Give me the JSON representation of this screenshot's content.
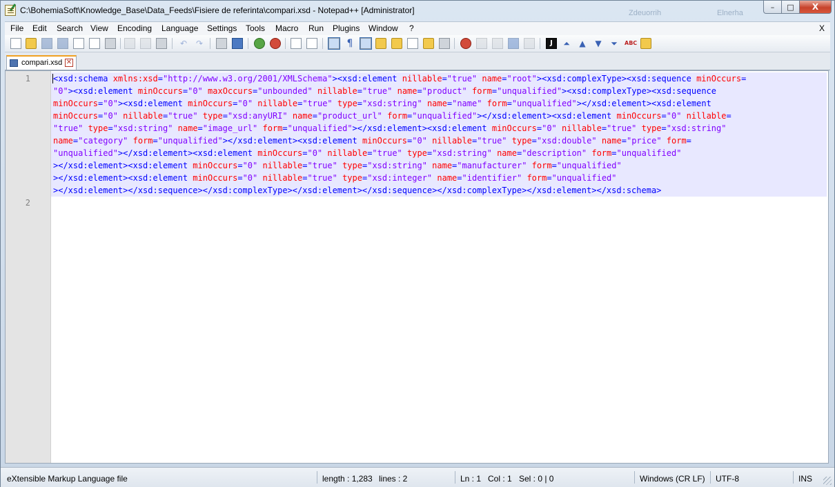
{
  "window": {
    "title": "C:\\BohemiaSoft\\Knowledge_Base\\Data_Feeds\\Fisiere de referinta\\compari.xsd - Notepad++ [Administrator]",
    "min_glyph": "–",
    "max_glyph": "□",
    "close_glyph": "X"
  },
  "background_text": {
    "left": "Zdeuorrih",
    "right": "Elnerha"
  },
  "menu": {
    "items": [
      "File",
      "Edit",
      "Search",
      "View",
      "Encoding",
      "Language",
      "Settings",
      "Tools",
      "Macro",
      "Run",
      "Plugins",
      "Window",
      "?"
    ],
    "close_glyph": "X"
  },
  "toolbar": {
    "icons": [
      "new-file-icon",
      "open-file-icon",
      "save-icon",
      "save-all-icon",
      "close-icon",
      "close-all-icon",
      "print-icon",
      "cut-icon",
      "copy-icon",
      "paste-icon",
      "undo-icon",
      "redo-icon",
      "find-icon",
      "replace-icon",
      "zoom-in-icon",
      "zoom-out-icon",
      "sync-vertical-icon",
      "sync-horizontal-icon",
      "word-wrap-icon",
      "show-all-chars-icon",
      "indent-guide-icon",
      "user-language-icon",
      "doc-map-icon",
      "function-list-icon",
      "folder-workspace-icon",
      "monitoring-icon",
      "record-macro-icon",
      "stop-macro-icon",
      "play-macro-icon",
      "run-macro-multiple-icon",
      "save-macro-icon",
      "jslint-icon",
      "collapse-icon",
      "up-arrow-icon",
      "down-arrow-icon",
      "expand-icon",
      "spell-check-icon",
      "compare-icon"
    ],
    "black_box_glyph": "J",
    "pilcrow_glyph": "¶",
    "abc_glyph": "ABC"
  },
  "tabs": [
    {
      "label": "compari.xsd",
      "close_glyph": "✕"
    }
  ],
  "editor": {
    "line_numbers": [
      "1",
      "2"
    ],
    "lines": [
      [
        [
          "t",
          "<xsd:schema "
        ],
        [
          "a",
          "xmlns:xsd"
        ],
        [
          "t",
          "="
        ],
        [
          "v",
          "\"http://www.w3.org/2001/XMLSchema\""
        ],
        [
          "t",
          "><xsd:element "
        ],
        [
          "a",
          "nillable"
        ],
        [
          "t",
          "="
        ],
        [
          "v",
          "\"true\" "
        ],
        [
          "a",
          "name"
        ],
        [
          "t",
          "="
        ],
        [
          "v",
          "\"root\""
        ],
        [
          "t",
          "><xsd:complexType><xsd:sequence "
        ],
        [
          "a",
          "minOccurs"
        ],
        [
          "t",
          "="
        ]
      ],
      [
        [
          "v",
          "\"0\""
        ],
        [
          "t",
          "><xsd:element "
        ],
        [
          "a",
          "minOccurs"
        ],
        [
          "t",
          "="
        ],
        [
          "v",
          "\"0\" "
        ],
        [
          "a",
          "maxOccurs"
        ],
        [
          "t",
          "="
        ],
        [
          "v",
          "\"unbounded\" "
        ],
        [
          "a",
          "nillable"
        ],
        [
          "t",
          "="
        ],
        [
          "v",
          "\"true\" "
        ],
        [
          "a",
          "name"
        ],
        [
          "t",
          "="
        ],
        [
          "v",
          "\"product\" "
        ],
        [
          "a",
          "form"
        ],
        [
          "t",
          "="
        ],
        [
          "v",
          "\"unqualified\""
        ],
        [
          "t",
          "><xsd:complexType><xsd:sequence"
        ]
      ],
      [
        [
          "a",
          "minOccurs"
        ],
        [
          "t",
          "="
        ],
        [
          "v",
          "\"0\""
        ],
        [
          "t",
          "><xsd:element "
        ],
        [
          "a",
          "minOccurs"
        ],
        [
          "t",
          "="
        ],
        [
          "v",
          "\"0\" "
        ],
        [
          "a",
          "nillable"
        ],
        [
          "t",
          "="
        ],
        [
          "v",
          "\"true\" "
        ],
        [
          "a",
          "type"
        ],
        [
          "t",
          "="
        ],
        [
          "v",
          "\"xsd:string\" "
        ],
        [
          "a",
          "name"
        ],
        [
          "t",
          "="
        ],
        [
          "v",
          "\"name\" "
        ],
        [
          "a",
          "form"
        ],
        [
          "t",
          "="
        ],
        [
          "v",
          "\"unqualified\""
        ],
        [
          "t",
          "></xsd:element><xsd:element"
        ]
      ],
      [
        [
          "a",
          "minOccurs"
        ],
        [
          "t",
          "="
        ],
        [
          "v",
          "\"0\" "
        ],
        [
          "a",
          "nillable"
        ],
        [
          "t",
          "="
        ],
        [
          "v",
          "\"true\" "
        ],
        [
          "a",
          "type"
        ],
        [
          "t",
          "="
        ],
        [
          "v",
          "\"xsd:anyURI\" "
        ],
        [
          "a",
          "name"
        ],
        [
          "t",
          "="
        ],
        [
          "v",
          "\"product_url\" "
        ],
        [
          "a",
          "form"
        ],
        [
          "t",
          "="
        ],
        [
          "v",
          "\"unqualified\""
        ],
        [
          "t",
          "></xsd:element><xsd:element "
        ],
        [
          "a",
          "minOccurs"
        ],
        [
          "t",
          "="
        ],
        [
          "v",
          "\"0\" "
        ],
        [
          "a",
          "nillable"
        ],
        [
          "t",
          "="
        ]
      ],
      [
        [
          "v",
          "\"true\" "
        ],
        [
          "a",
          "type"
        ],
        [
          "t",
          "="
        ],
        [
          "v",
          "\"xsd:string\" "
        ],
        [
          "a",
          "name"
        ],
        [
          "t",
          "="
        ],
        [
          "v",
          "\"image_url\" "
        ],
        [
          "a",
          "form"
        ],
        [
          "t",
          "="
        ],
        [
          "v",
          "\"unqualified\""
        ],
        [
          "t",
          "></xsd:element><xsd:element "
        ],
        [
          "a",
          "minOccurs"
        ],
        [
          "t",
          "="
        ],
        [
          "v",
          "\"0\" "
        ],
        [
          "a",
          "nillable"
        ],
        [
          "t",
          "="
        ],
        [
          "v",
          "\"true\" "
        ],
        [
          "a",
          "type"
        ],
        [
          "t",
          "="
        ],
        [
          "v",
          "\"xsd:string\""
        ]
      ],
      [
        [
          "a",
          "name"
        ],
        [
          "t",
          "="
        ],
        [
          "v",
          "\"category\" "
        ],
        [
          "a",
          "form"
        ],
        [
          "t",
          "="
        ],
        [
          "v",
          "\"unqualified\""
        ],
        [
          "t",
          "></xsd:element><xsd:element "
        ],
        [
          "a",
          "minOccurs"
        ],
        [
          "t",
          "="
        ],
        [
          "v",
          "\"0\" "
        ],
        [
          "a",
          "nillable"
        ],
        [
          "t",
          "="
        ],
        [
          "v",
          "\"true\" "
        ],
        [
          "a",
          "type"
        ],
        [
          "t",
          "="
        ],
        [
          "v",
          "\"xsd:double\" "
        ],
        [
          "a",
          "name"
        ],
        [
          "t",
          "="
        ],
        [
          "v",
          "\"price\" "
        ],
        [
          "a",
          "form"
        ],
        [
          "t",
          "="
        ]
      ],
      [
        [
          "v",
          "\"unqualified\""
        ],
        [
          "t",
          "></xsd:element><xsd:element "
        ],
        [
          "a",
          "minOccurs"
        ],
        [
          "t",
          "="
        ],
        [
          "v",
          "\"0\" "
        ],
        [
          "a",
          "nillable"
        ],
        [
          "t",
          "="
        ],
        [
          "v",
          "\"true\" "
        ],
        [
          "a",
          "type"
        ],
        [
          "t",
          "="
        ],
        [
          "v",
          "\"xsd:string\" "
        ],
        [
          "a",
          "name"
        ],
        [
          "t",
          "="
        ],
        [
          "v",
          "\"description\" "
        ],
        [
          "a",
          "form"
        ],
        [
          "t",
          "="
        ],
        [
          "v",
          "\"unqualified\""
        ]
      ],
      [
        [
          "t",
          "></xsd:element><xsd:element "
        ],
        [
          "a",
          "minOccurs"
        ],
        [
          "t",
          "="
        ],
        [
          "v",
          "\"0\" "
        ],
        [
          "a",
          "nillable"
        ],
        [
          "t",
          "="
        ],
        [
          "v",
          "\"true\" "
        ],
        [
          "a",
          "type"
        ],
        [
          "t",
          "="
        ],
        [
          "v",
          "\"xsd:string\" "
        ],
        [
          "a",
          "name"
        ],
        [
          "t",
          "="
        ],
        [
          "v",
          "\"manufacturer\" "
        ],
        [
          "a",
          "form"
        ],
        [
          "t",
          "="
        ],
        [
          "v",
          "\"unqualified\""
        ]
      ],
      [
        [
          "t",
          "></xsd:element><xsd:element "
        ],
        [
          "a",
          "minOccurs"
        ],
        [
          "t",
          "="
        ],
        [
          "v",
          "\"0\" "
        ],
        [
          "a",
          "nillable"
        ],
        [
          "t",
          "="
        ],
        [
          "v",
          "\"true\" "
        ],
        [
          "a",
          "type"
        ],
        [
          "t",
          "="
        ],
        [
          "v",
          "\"xsd:integer\" "
        ],
        [
          "a",
          "name"
        ],
        [
          "t",
          "="
        ],
        [
          "v",
          "\"identifier\" "
        ],
        [
          "a",
          "form"
        ],
        [
          "t",
          "="
        ],
        [
          "v",
          "\"unqualified\""
        ]
      ],
      [
        [
          "t",
          "></xsd:element></xsd:sequence></xsd:complexType></xsd:element></xsd:sequence></xsd:complexType></xsd:element></xsd:schema>"
        ]
      ]
    ]
  },
  "status": {
    "file_type": "eXtensible Markup Language file",
    "length": "length : 1,283",
    "lines": "lines : 2",
    "ln": "Ln : 1",
    "col": "Col : 1",
    "sel": "Sel : 0 | 0",
    "eol": "Windows (CR LF)",
    "encoding": "UTF-8",
    "mode": "INS"
  }
}
